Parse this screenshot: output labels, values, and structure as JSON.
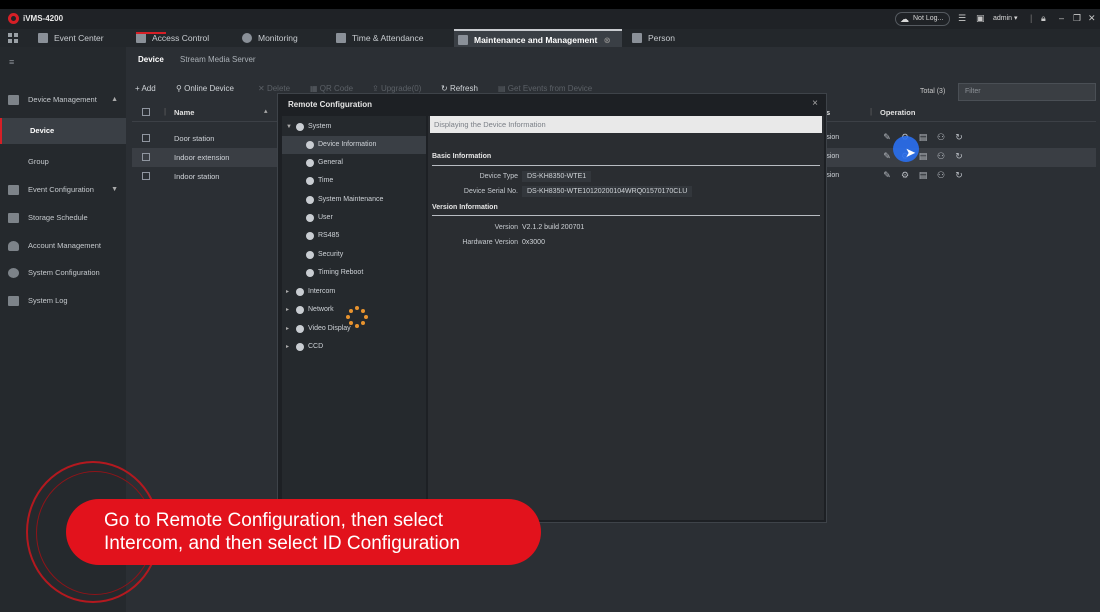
{
  "app": {
    "title": "iVMS-4200"
  },
  "titlebar": {
    "cloud_status": "Not Log...",
    "user": "admin"
  },
  "module_tabs": [
    {
      "label": "Event Center"
    },
    {
      "label": "Access Control"
    },
    {
      "label": "Monitoring"
    },
    {
      "label": "Time & Attendance"
    },
    {
      "label": "Maintenance and Management",
      "active": true
    },
    {
      "label": "Person"
    }
  ],
  "sidebar": {
    "items": [
      {
        "label": "Device Management"
      },
      {
        "label": "Device",
        "active": true
      },
      {
        "label": "Group"
      },
      {
        "label": "Event Configuration"
      },
      {
        "label": "Storage Schedule"
      },
      {
        "label": "Account Management"
      },
      {
        "label": "System Configuration"
      },
      {
        "label": "System Log"
      }
    ]
  },
  "subtabs": {
    "device": "Device",
    "stream": "Stream Media Server"
  },
  "toolbar": {
    "add": "+ Add",
    "online": "Online Device",
    "delete": "Delete",
    "qr": "QR Code",
    "upgrade": "Upgrade(0)",
    "refresh": "Refresh",
    "get_events": "Get Events from Device",
    "total": "Total (3)",
    "filter_placeholder": "Filter"
  },
  "device_table": {
    "col_name": "Name",
    "col_operation": "Operation",
    "col_version_partial": "s",
    "rows": [
      {
        "name": "Door station",
        "version_partial": "rsion"
      },
      {
        "name": "Indoor extension",
        "version_partial": "rsion"
      },
      {
        "name": "Indoor station",
        "version_partial": "rsion"
      }
    ]
  },
  "remote_config": {
    "title": "Remote Configuration",
    "close": "×",
    "tree": {
      "system": "System",
      "system_children": [
        "Device Information",
        "General",
        "Time",
        "System Maintenance",
        "User",
        "RS485",
        "Security",
        "Timing Reboot"
      ],
      "other": [
        "Intercom",
        "Network",
        "Video Display",
        "CCD"
      ]
    },
    "status": "Displaying the Device Information",
    "basic_heading": "Basic Information",
    "device_type_label": "Device Type",
    "device_type": "DS-KH8350-WTE1",
    "serial_label": "Device Serial No.",
    "serial": "DS-KH8350-WTE10120200104WRQ01570170CLU",
    "version_heading": "Version Information",
    "version_label": "Version",
    "version": "V2.1.2 build 200701",
    "hw_label": "Hardware Version",
    "hw": "0x3000"
  },
  "caption": {
    "line1": "Go to Remote Configuration, then select",
    "line2": "Intercom, and then select ID Configuration"
  },
  "colors": {
    "accent": "#d61f26",
    "caption_bg": "#e2121c",
    "highlight": "#2a6ff0"
  }
}
